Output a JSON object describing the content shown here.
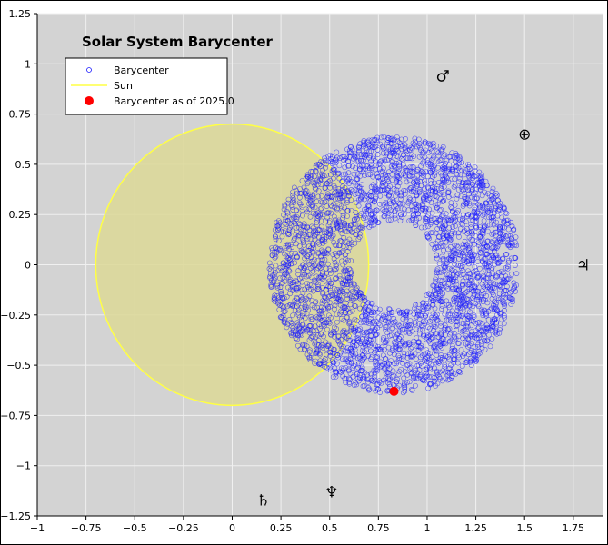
{
  "chart_data": {
    "type": "scatter",
    "title": "Solar System Barycenter",
    "xlabel": "",
    "ylabel": "",
    "xlim": [
      -1,
      1.9
    ],
    "ylim": [
      -1.25,
      1.25
    ],
    "xticks": [
      "−1",
      "−0.75",
      "−0.5",
      "−0.25",
      "0",
      "0.25",
      "0.5",
      "0.75",
      "1",
      "1.25",
      "1.5",
      "1.75"
    ],
    "xtick_values": [
      -1,
      -0.75,
      -0.5,
      -0.25,
      0,
      0.25,
      0.5,
      0.75,
      1,
      1.25,
      1.5,
      1.75
    ],
    "yticks": [
      "1.25",
      "1",
      "0.75",
      "0.5",
      "0.25",
      "0",
      "−0.25",
      "−0.5",
      "−0.75",
      "−1",
      "−1.25"
    ],
    "ytick_values": [
      1.25,
      1,
      0.75,
      0.5,
      0.25,
      0,
      -0.25,
      -0.5,
      -0.75,
      -1,
      -1.25
    ],
    "grid": true,
    "legend_position": "top-left",
    "colors": {
      "plot_background": "#d3d3d3",
      "grid": "#f0f0f0",
      "barycenter": "#1a1aff",
      "sun_fill": "#dcd896",
      "sun_edge": "#ffff44",
      "current": "#ff0000"
    },
    "series": [
      {
        "name": "Barycenter",
        "kind": "scatter-ring",
        "center": [
          0.83,
          0.0
        ],
        "inner_radius": 0.22,
        "outer_radius": 0.64
      },
      {
        "name": "Sun",
        "kind": "circle",
        "center": [
          0.0,
          0.0
        ],
        "radius": 0.7
      },
      {
        "name": "Barycenter as of 2025.0",
        "kind": "point",
        "x": 0.83,
        "y": -0.63
      }
    ],
    "planet_markers": [
      {
        "symbol": "♂",
        "name": "Mars",
        "x": 1.08,
        "y": 0.94
      },
      {
        "symbol": "⊕",
        "name": "Earth",
        "x": 1.5,
        "y": 0.65
      },
      {
        "symbol": "♃",
        "name": "Jupiter",
        "x": 1.8,
        "y": 0.0
      },
      {
        "symbol": "♄",
        "name": "Saturn",
        "x": 0.16,
        "y": -1.17
      },
      {
        "symbol": "♆",
        "name": "Neptune",
        "x": 0.51,
        "y": -1.13
      }
    ]
  }
}
